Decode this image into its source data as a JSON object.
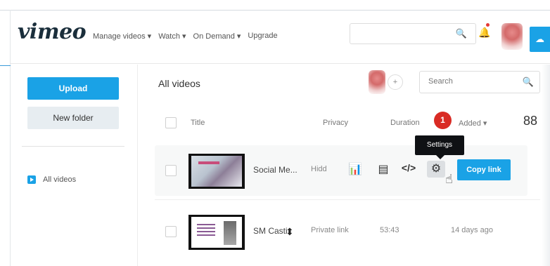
{
  "header": {
    "logo": "vimeo",
    "nav": [
      "Manage videos ▾",
      "Watch ▾",
      "On Demand ▾",
      "Upgrade"
    ],
    "search_placeholder": "",
    "search_icon": "🔍"
  },
  "sidebar": {
    "upload_label": "Upload",
    "new_folder_label": "New folder",
    "items": [
      {
        "label": "All videos"
      }
    ]
  },
  "main": {
    "title": "All videos",
    "search_placeholder": "Search",
    "search_icon": "🔍",
    "avatar_plus": "+",
    "columns": {
      "title": "Title",
      "privacy": "Privacy",
      "duration": "Duration",
      "added": "Added ▾"
    },
    "grid_icon": "88",
    "step_badge": "1",
    "tooltip": "Settings",
    "videos": [
      {
        "title": "Social Me...",
        "privacy": "Hidd",
        "duration": "",
        "added": ""
      },
      {
        "title": "SM Casti",
        "privacy": "Private link",
        "duration": "53:43",
        "added": "14 days ago"
      }
    ],
    "actions": {
      "stats_icon": "📊",
      "review_icon": "▤",
      "embed_icon": "</>",
      "settings_icon": "⚙",
      "copy_link": "Copy link",
      "cursor_icon": "☝"
    }
  },
  "colors": {
    "accent": "#1aa2e6",
    "badge": "#d92b24",
    "tooltip_bg": "#0f1114"
  }
}
